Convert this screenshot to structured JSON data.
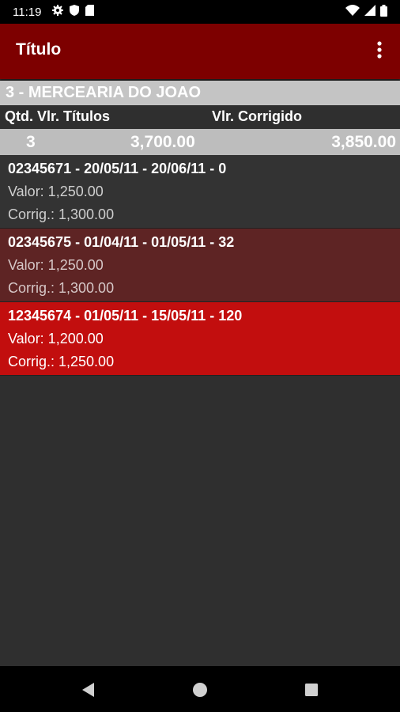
{
  "status_bar": {
    "time": "11:19",
    "left_icons": [
      "gear-icon",
      "shield-icon",
      "sd-card-icon"
    ],
    "right_icons": [
      "wifi-icon",
      "signal-icon",
      "battery-icon"
    ]
  },
  "app_bar": {
    "title": "Título",
    "overflow_icon": "more-vert-icon",
    "color": "#7d0000"
  },
  "client": {
    "name": "3 - MERCEARIA DO JOAO"
  },
  "summary": {
    "header_qtd_label": "Qtd. Vlr. Títulos",
    "header_corrigido_label": "Vlr. Corrigido",
    "qtd": "3",
    "total": "3,700.00",
    "corrigido": "3,850.00"
  },
  "titulos": [
    {
      "header": "02345671 - 20/05/11 - 20/06/11 - 0",
      "valor": "Valor: 1,250.00",
      "corrig": "Corrig.: 1,300.00",
      "row_color": "#333333"
    },
    {
      "header": "02345675 - 01/04/11 - 01/05/11 - 32",
      "valor": "Valor: 1,250.00",
      "corrig": "Corrig.: 1,300.00",
      "row_color": "#5e2424"
    },
    {
      "header": "12345674 - 01/05/11 - 15/05/11 - 120",
      "valor": "Valor: 1,200.00",
      "corrig": "Corrig.: 1,250.00",
      "row_color": "#c20e0e"
    }
  ],
  "nav_bar": {
    "buttons": [
      "back-icon",
      "home-icon",
      "recents-icon"
    ]
  }
}
